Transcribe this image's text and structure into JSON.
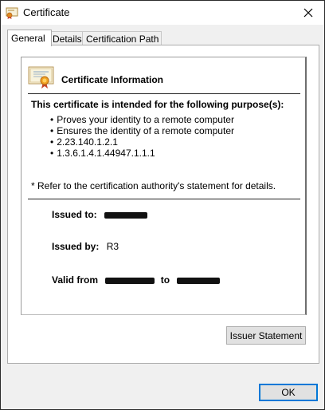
{
  "window": {
    "title": "Certificate",
    "close_icon": "close-icon",
    "title_icon": "certificate-icon"
  },
  "tabs": [
    {
      "label": "General",
      "active": true
    },
    {
      "label": "Details",
      "active": false
    },
    {
      "label": "Certification Path",
      "active": false
    }
  ],
  "general": {
    "heading": "Certificate Information",
    "purpose_heading": "This certificate is intended for the following purpose(s):",
    "purposes": [
      "Proves your identity to a remote computer",
      "Ensures the identity of a remote computer",
      "2.23.140.1.2.1",
      "1.3.6.1.4.1.44947.1.1.1"
    ],
    "refer_note": "* Refer to the certification authority's statement for details.",
    "issued_to_label": "Issued to:",
    "issued_by_label": "Issued by:",
    "issued_by_value": "R3",
    "valid_from_label": "Valid from",
    "valid_to_label": "to"
  },
  "buttons": {
    "issuer_statement": "Issuer Statement",
    "ok": "OK"
  },
  "colors": {
    "ok_border": "#0078d7",
    "window_bg": "#f0f0f0",
    "redaction": "#111111"
  }
}
